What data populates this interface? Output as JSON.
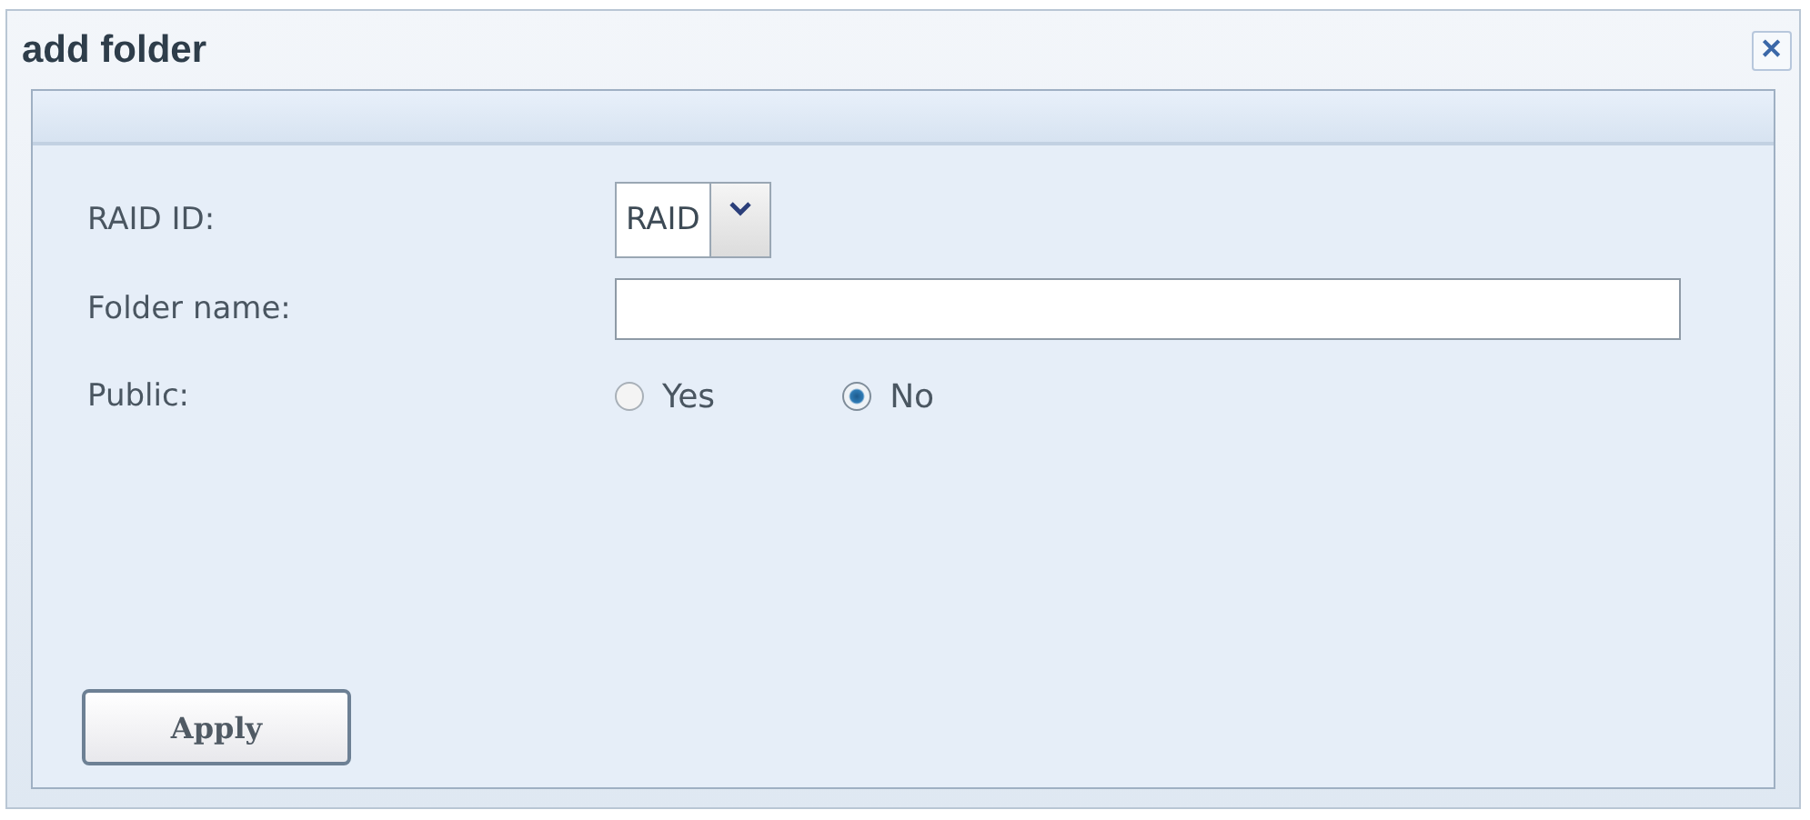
{
  "window": {
    "title": "add folder",
    "close": "✕"
  },
  "form": {
    "raid_id": {
      "label": "RAID ID:",
      "value": "RAID"
    },
    "folder_name": {
      "label": "Folder name:"
    },
    "public": {
      "label": "Public:",
      "options": [
        {
          "label": "Yes",
          "selected": false
        },
        {
          "label": "No",
          "selected": true
        }
      ]
    }
  },
  "buttons": [
    {
      "label": "Apply"
    }
  ]
}
